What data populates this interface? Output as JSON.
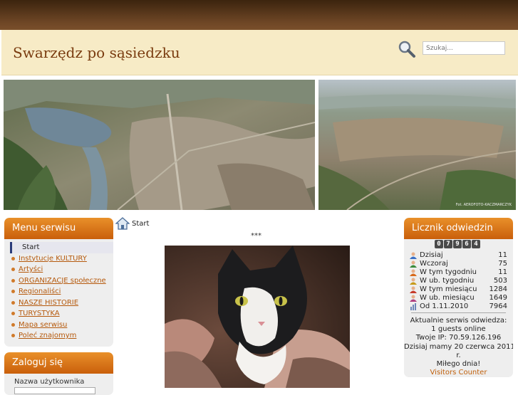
{
  "header": {
    "site_title": "Swarzędz po sąsiedzku",
    "search_placeholder": "Szukaj..."
  },
  "banner": {
    "left_alt": "aerial photo of Swarzędz with lake",
    "right_alt": "aerial photo of Swarzędz town",
    "photo_credit": "Fot. AEROFOTO-KACZMARCZYK"
  },
  "menu": {
    "title": "Menu serwisu",
    "items": [
      {
        "label": "Start",
        "active": true
      },
      {
        "label": "Instytucje KULTURY"
      },
      {
        "label": "Artyści"
      },
      {
        "label": "ORGANIZACJE społeczne"
      },
      {
        "label": "Regionaliści"
      },
      {
        "label": "NASZE HISTORIE"
      },
      {
        "label": "TURYSTYKA"
      },
      {
        "label": "Mapa serwisu"
      },
      {
        "label": "Poleć znajomym"
      }
    ]
  },
  "login": {
    "title": "Zaloguj się",
    "username_label": "Nazwa użytkownika"
  },
  "content": {
    "breadcrumb": "Start",
    "separator": "***",
    "image_alt": "black and white kitten"
  },
  "counter": {
    "title": "Licznik odwiedzin",
    "total_digits": "07964",
    "stats": [
      {
        "label": "Dzisiaj",
        "value": "11",
        "color": "#3b6fc4"
      },
      {
        "label": "Wczoraj",
        "value": "75",
        "color": "#3b8a3b"
      },
      {
        "label": "W tym tygodniu",
        "value": "11",
        "color": "#d86a1c"
      },
      {
        "label": "W ub. tygodniu",
        "value": "503",
        "color": "#c79a1a"
      },
      {
        "label": "W tym miesiącu",
        "value": "1284",
        "color": "#c63a2a"
      },
      {
        "label": "W ub. miesiącu",
        "value": "1649",
        "color": "#b04080"
      },
      {
        "label": "Od 1.11.2010",
        "value": "7964",
        "color": "#6d86b8"
      }
    ],
    "now_visiting": "Aktualnie serwis odwiedza:",
    "guests_online": "1 guests online",
    "your_ip": "Twoje IP: 70.59.126.196",
    "today_date_line1": "Dzisiaj mamy 20 czerwca 2011",
    "today_date_line2": "r.",
    "greeting": "Miłego dnia!",
    "visitors_counter_link": "Visitors Counter"
  },
  "colors": {
    "accent": "#d97a1f",
    "header_bg": "#f7ebc6",
    "link": "#b5590c"
  }
}
